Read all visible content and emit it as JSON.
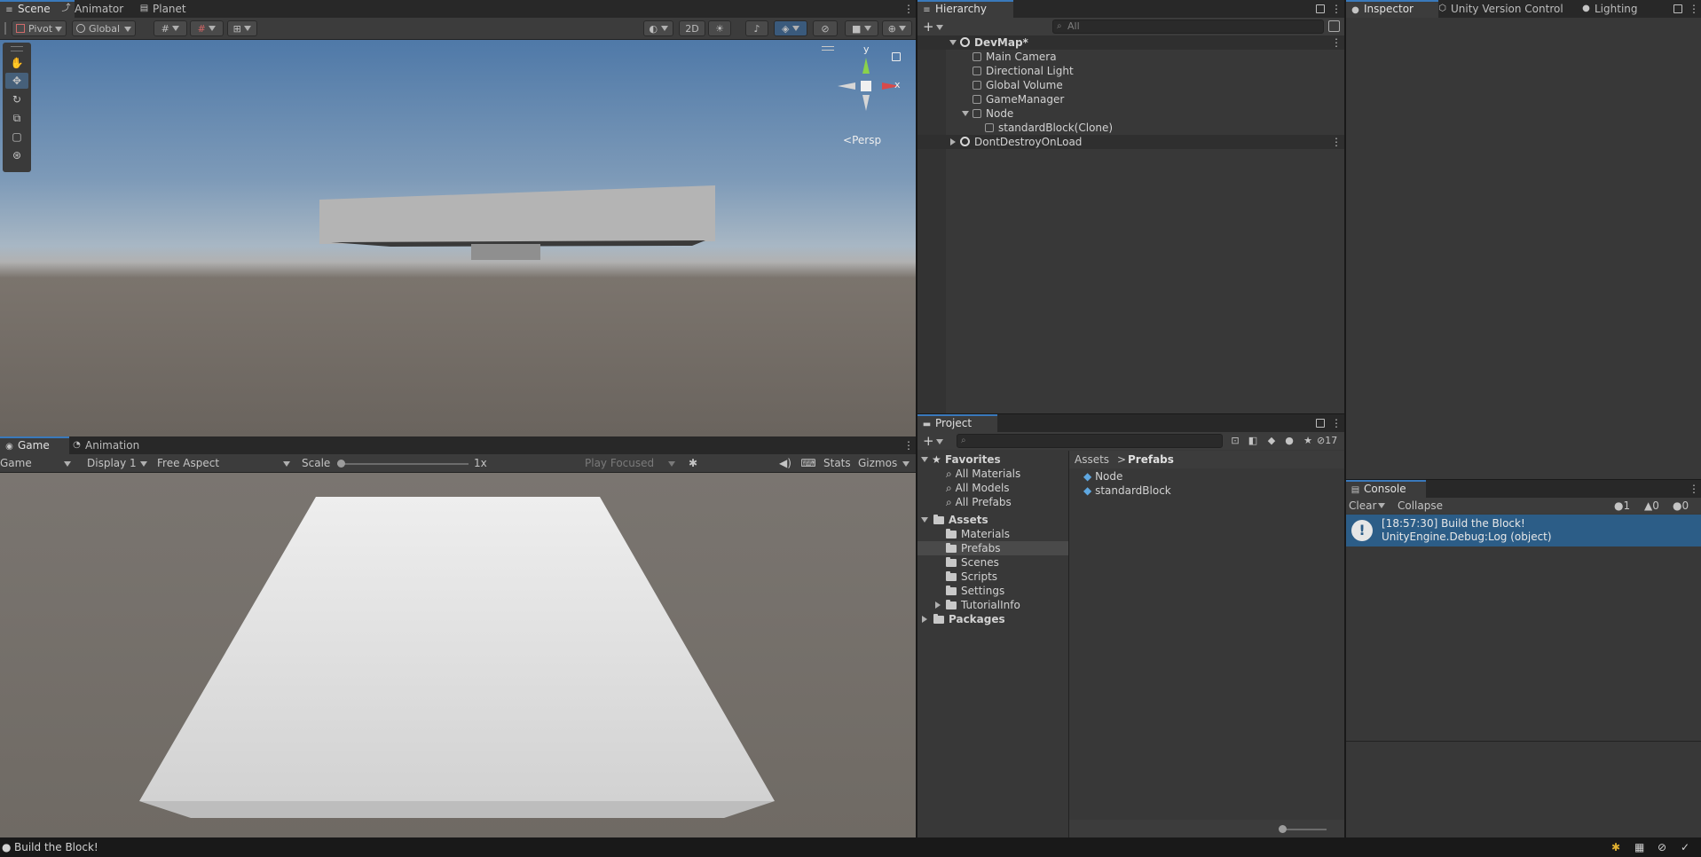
{
  "scene_window": {
    "tabs": [
      {
        "label": "Scene",
        "icon": "grid-icon"
      },
      {
        "label": "Animator",
        "icon": "animator-icon"
      },
      {
        "label": "Planet",
        "icon": "planet-icon"
      }
    ],
    "pivot_label": "Pivot",
    "global_label": "Global",
    "btn_2d": "2D",
    "gizmo_axis_y": "y",
    "gizmo_axis_x": "x",
    "projection_label": "Persp"
  },
  "game_window": {
    "tabs": [
      {
        "label": "Game",
        "icon": "gamepad-icon"
      },
      {
        "label": "Animation",
        "icon": "animation-icon"
      }
    ],
    "mode_select": "Game",
    "display_select": "Display 1",
    "aspect_select": "Free Aspect",
    "scale_label": "Scale",
    "scale_value": "1x",
    "play_focused": "Play Focused",
    "stats_label": "Stats",
    "gizmos_label": "Gizmos"
  },
  "hierarchy": {
    "tab_label": "Hierarchy",
    "search_placeholder": "All",
    "items": [
      {
        "label": "DevMap*",
        "type": "scene",
        "expanded": true
      },
      {
        "label": "Main Camera",
        "type": "object"
      },
      {
        "label": "Directional Light",
        "type": "object"
      },
      {
        "label": "Global Volume",
        "type": "object"
      },
      {
        "label": "GameManager",
        "type": "object"
      },
      {
        "label": "Node",
        "type": "object",
        "expanded": true
      },
      {
        "label": "standardBlock(Clone)",
        "type": "object"
      },
      {
        "label": "DontDestroyOnLoad",
        "type": "scene",
        "expanded": false
      }
    ]
  },
  "inspector": {
    "tabs": [
      {
        "label": "Inspector",
        "icon": "info-icon"
      },
      {
        "label": "Unity Version Control",
        "icon": "version-control-icon"
      },
      {
        "label": "Lighting",
        "icon": "lightbulb-icon"
      }
    ]
  },
  "project": {
    "tab_label": "Project",
    "hidden_count": "17",
    "favorites_label": "Favorites",
    "favorites": [
      "All Materials",
      "All Models",
      "All Prefabs"
    ],
    "assets_label": "Assets",
    "asset_folders": [
      "Materials",
      "Prefabs",
      "Scenes",
      "Scripts",
      "Settings",
      "TutorialInfo"
    ],
    "packages_label": "Packages",
    "breadcrumb": [
      "Assets",
      "Prefabs"
    ],
    "files": [
      "Node",
      "standardBlock"
    ]
  },
  "console": {
    "tab_label": "Console",
    "clear_label": "Clear",
    "collapse_label": "Collapse",
    "counts": {
      "log": "1",
      "warning": "0",
      "error": "0"
    },
    "entries": [
      {
        "line1": "[18:57:30] Build the Block!",
        "line2": "UnityEngine.Debug:Log (object)"
      }
    ]
  },
  "status_bar": {
    "message": "Build the Block!"
  },
  "colors": {
    "accent_blue": "#3a79bb",
    "selection_blue": "#2c5d87",
    "panel_bg": "#383838",
    "header_bg": "#282828"
  }
}
